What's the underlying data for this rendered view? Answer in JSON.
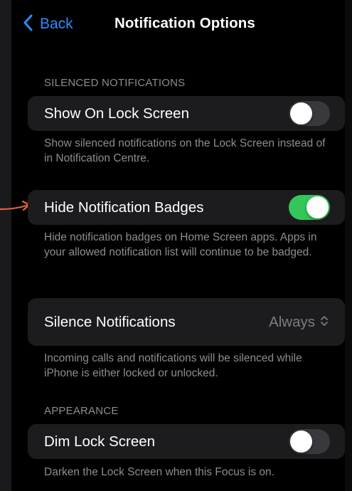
{
  "nav": {
    "back_label": "Back",
    "title": "Notification Options"
  },
  "sections": {
    "silenced": {
      "header": "SILENCED NOTIFICATIONS",
      "show_on_lock": {
        "label": "Show On Lock Screen",
        "toggle_on": false,
        "footer": "Show silenced notifications on the Lock Screen instead of in Notification Centre."
      },
      "hide_badges": {
        "label": "Hide Notification Badges",
        "toggle_on": true,
        "footer": "Hide notification badges on Home Screen apps. Apps in your allowed notification list will continue to be badged."
      }
    },
    "silence": {
      "label": "Silence Notifications",
      "value": "Always",
      "footer": "Incoming calls and notifications will be silenced while iPhone is either locked or unlocked."
    },
    "appearance": {
      "header": "APPEARANCE",
      "dim_lock": {
        "label": "Dim Lock Screen",
        "toggle_on": false,
        "footer": "Darken the Lock Screen when this Focus is on."
      }
    }
  },
  "colors": {
    "accent": "#2d8cff",
    "toggle_on": "#33c759",
    "toggle_off": "#39393d",
    "card": "#1c1c1e",
    "secondary_text": "#8d8d93",
    "annotation_arrow": "#e2643a"
  },
  "icons": {
    "back": "chevron-left-icon",
    "value_picker": "chevron-up-down-icon",
    "annotation": "arrow-right-icon"
  }
}
